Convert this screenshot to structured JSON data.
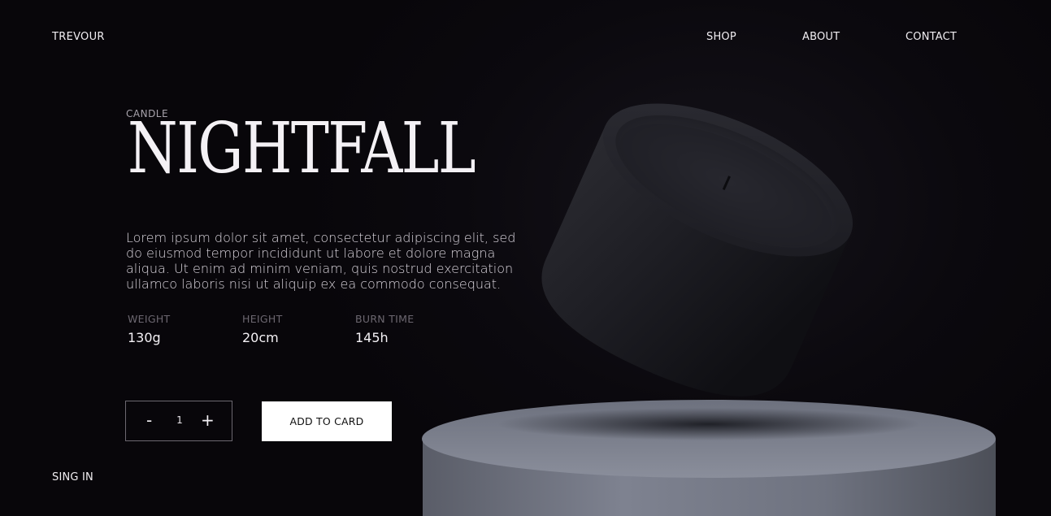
{
  "header": {
    "brand": "TREVOUR",
    "nav": [
      "SHOP",
      "ABOUT",
      "CONTACT"
    ]
  },
  "product": {
    "category": "CANDLE",
    "name": "NIGHTFALL",
    "description": "Lorem ipsum dolor sit amet, consectetur adipiscing elit, sed do eiusmod tempor incididunt ut labore et dolore magna aliqua. Ut enim ad minim veniam, quis nostrud exercitation ullamco laboris nisi ut aliquip ex ea commodo consequat.",
    "specs": [
      {
        "label": "WEIGHT",
        "value": "130g"
      },
      {
        "label": "HEIGHT",
        "value": "20cm"
      },
      {
        "label": "BURN TIME",
        "value": "145h"
      }
    ]
  },
  "cart": {
    "minus": "-",
    "quantity": "1",
    "plus": "+",
    "add_label": "ADD TO CARD"
  },
  "footer": {
    "signin": "SING IN"
  },
  "colors": {
    "background": "#0a070c",
    "text": "#f4f1f5",
    "muted": "#6c6770",
    "button_bg": "#ffffff"
  },
  "icons": {
    "product_image": "candle-icon",
    "pedestal": "pedestal-icon"
  }
}
